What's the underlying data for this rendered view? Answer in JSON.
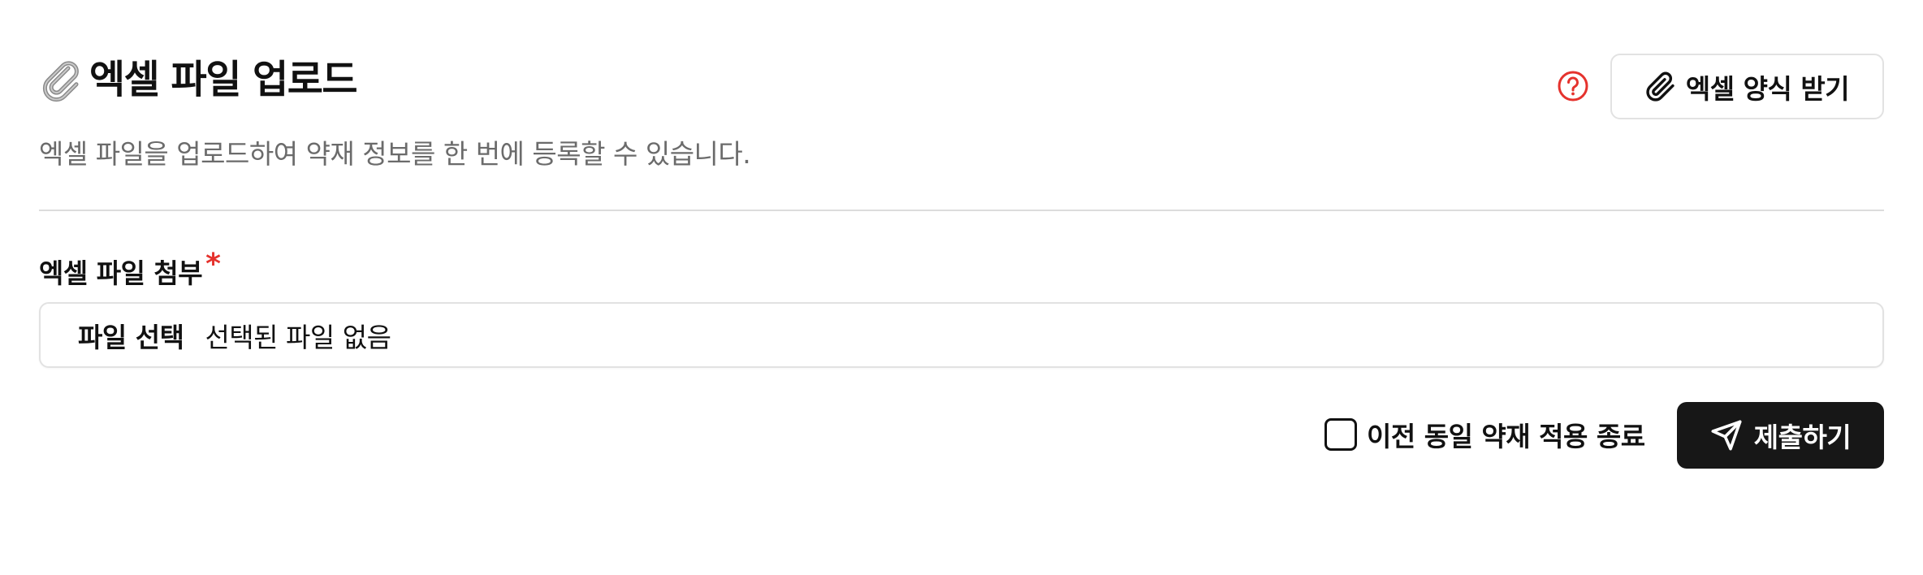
{
  "header": {
    "title": "엑셀 파일 업로드",
    "subtitle": "엑셀 파일을 업로드하여 약재 정보를 한 번에 등록할 수 있습니다.",
    "title_icon": "paperclip-emoji-icon"
  },
  "actions": {
    "help_icon": "help-circle-icon",
    "template_button_label": "엑셀 양식 받기",
    "template_button_icon": "paperclip-icon"
  },
  "form": {
    "file_field_label": "엑셀 파일 첨부",
    "required_mark": "*",
    "file_choose_label": "파일 선택",
    "file_status": "선택된 파일 없음",
    "checkbox_label": "이전 동일 약재 적용 종료",
    "checkbox_checked": false,
    "submit_label": "제출하기",
    "submit_icon": "send-icon"
  },
  "colors": {
    "accent_red": "#e5322d",
    "submit_bg": "#171717",
    "border": "#e2e2e2",
    "subtitle_gray": "#6b6b6b"
  }
}
